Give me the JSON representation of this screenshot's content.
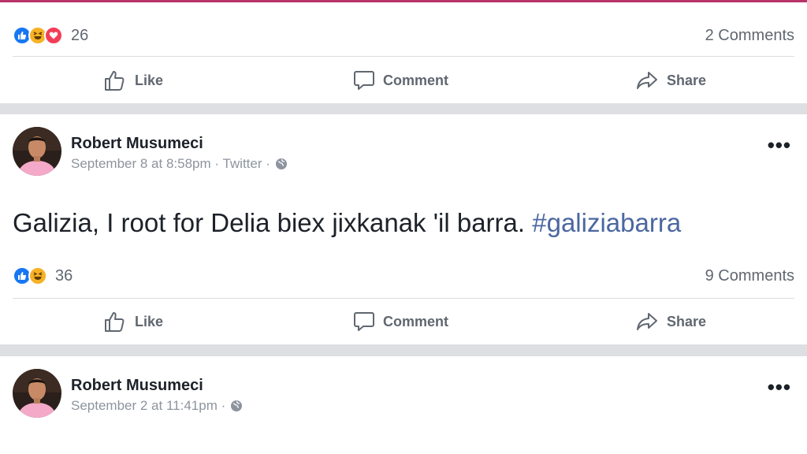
{
  "post1": {
    "reactions": [
      "like",
      "haha",
      "love"
    ],
    "reaction_count": "26",
    "comments": "2 Comments",
    "actions": {
      "like": "Like",
      "comment": "Comment",
      "share": "Share"
    }
  },
  "post2": {
    "author": "Robert Musumeci",
    "meta": "September 8 at 8:58pm · Twitter ·",
    "text": "Galizia, I root for Delia biex jixkanak 'il barra.",
    "hashtag": "#galiziabarra",
    "reactions": [
      "like",
      "haha"
    ],
    "reaction_count": "36",
    "comments": "9 Comments",
    "actions": {
      "like": "Like",
      "comment": "Comment",
      "share": "Share"
    }
  },
  "post3": {
    "author": "Robert Musumeci",
    "meta": "September 2 at 11:41pm ·"
  },
  "colors": {
    "accent_line": "#b8336a",
    "link": "#4b67a1",
    "like_blue": "#1877f2",
    "love_red": "#f33e58",
    "haha_yellow": "#f7b125"
  }
}
